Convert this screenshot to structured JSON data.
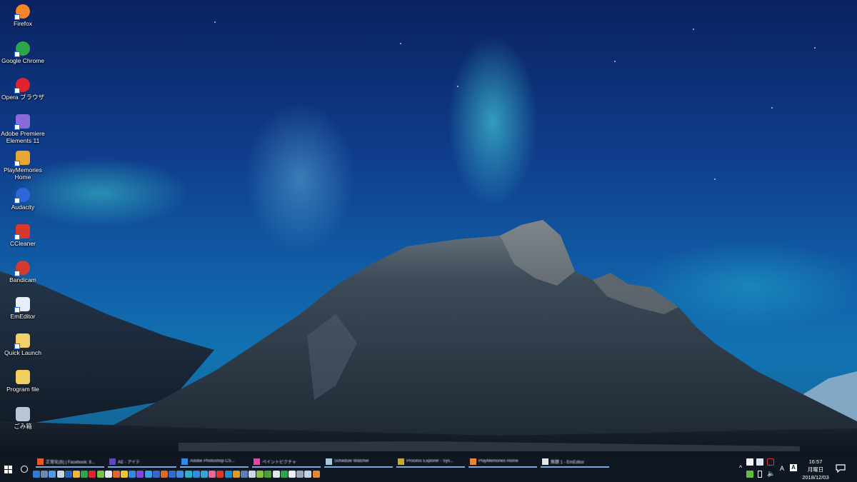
{
  "desktop": {
    "icons": [
      {
        "label": "Firefox",
        "icon": "firefox-icon",
        "color": "#f5862a"
      },
      {
        "label": "Google Chrome",
        "icon": "chrome-icon",
        "color": "#2fa54a"
      },
      {
        "label": "Opera ブラウザ",
        "icon": "opera-icon",
        "color": "#e0232f"
      },
      {
        "label": "Adobe Premiere Elements 11",
        "icon": "premiere-elements-icon",
        "color": "#8a6ad9"
      },
      {
        "label": "PlayMemories Home",
        "icon": "playmemories-icon",
        "color": "#e8a632"
      },
      {
        "label": "Audacity",
        "icon": "audacity-icon",
        "color": "#2e66d9"
      },
      {
        "label": "CCleaner",
        "icon": "ccleaner-icon",
        "color": "#d8372b"
      },
      {
        "label": "Bandicam",
        "icon": "bandicam-icon",
        "color": "#d63a2f"
      },
      {
        "label": "EmEditor",
        "icon": "emeditor-icon",
        "color": "#e8eef7"
      },
      {
        "label": "Quick Launch",
        "icon": "folder-shortcut-icon",
        "color": "#f1d06b"
      },
      {
        "label": "Program file",
        "icon": "folder-icon",
        "color": "#f1cf5e"
      },
      {
        "label": "ごみ箱",
        "icon": "recycle-bin-icon",
        "color": "#b9c6d3"
      }
    ]
  },
  "taskbar": {
    "start_icon": "windows-logo-icon",
    "search_icon": "cortana-icon",
    "open_windows": [
      {
        "label": "正常化(B) | Facebook: 8...",
        "color": "#e65c2a"
      },
      {
        "label": "AE - アイテ",
        "color": "#5f45c7"
      },
      {
        "label": "Adobe Photoshop CS...",
        "color": "#2f8ae0"
      },
      {
        "label": "ペイントピクチャ",
        "color": "#e04aa6"
      },
      {
        "label": "Schedule Watcher",
        "color": "#a9c8e0"
      },
      {
        "label": "Process Explorer - Sys...",
        "color": "#c9a92b"
      },
      {
        "label": "PlayMemories Home",
        "color": "#e8863a"
      },
      {
        "label": "無題 1 - EmEditor",
        "color": "#dfe6ee"
      }
    ],
    "quick_launch_colors": [
      "#2d7fd6",
      "#6a89b0",
      "#4d9be0",
      "#c8d5e2",
      "#2a62b8",
      "#f0b43a",
      "#2fa54a",
      "#e0232f",
      "#7bc04a",
      "#dfe6ee",
      "#e06a2a",
      "#f2c230",
      "#2f8ae0",
      "#7a4ad9",
      "#3aa0e6",
      "#3a67c8",
      "#d96c2a",
      "#2b6dd0",
      "#3f8ae8",
      "#2bb0c8",
      "#2f8ae0",
      "#33a6d6",
      "#e26b9a",
      "#d8372b",
      "#1b8cd0",
      "#e09a2a",
      "#5b7fb8",
      "#d0d8e4",
      "#88bf46",
      "#4e9c3a",
      "#e0e6ee",
      "#2fa54a",
      "#e8eef5",
      "#9aa8ba",
      "#c8d2de",
      "#e08a3a"
    ],
    "tray": {
      "chevron": "^",
      "clock_time": "16:57",
      "clock_day": "月曜日",
      "clock_date": "2018/12/03",
      "ime_mode": "A"
    }
  }
}
